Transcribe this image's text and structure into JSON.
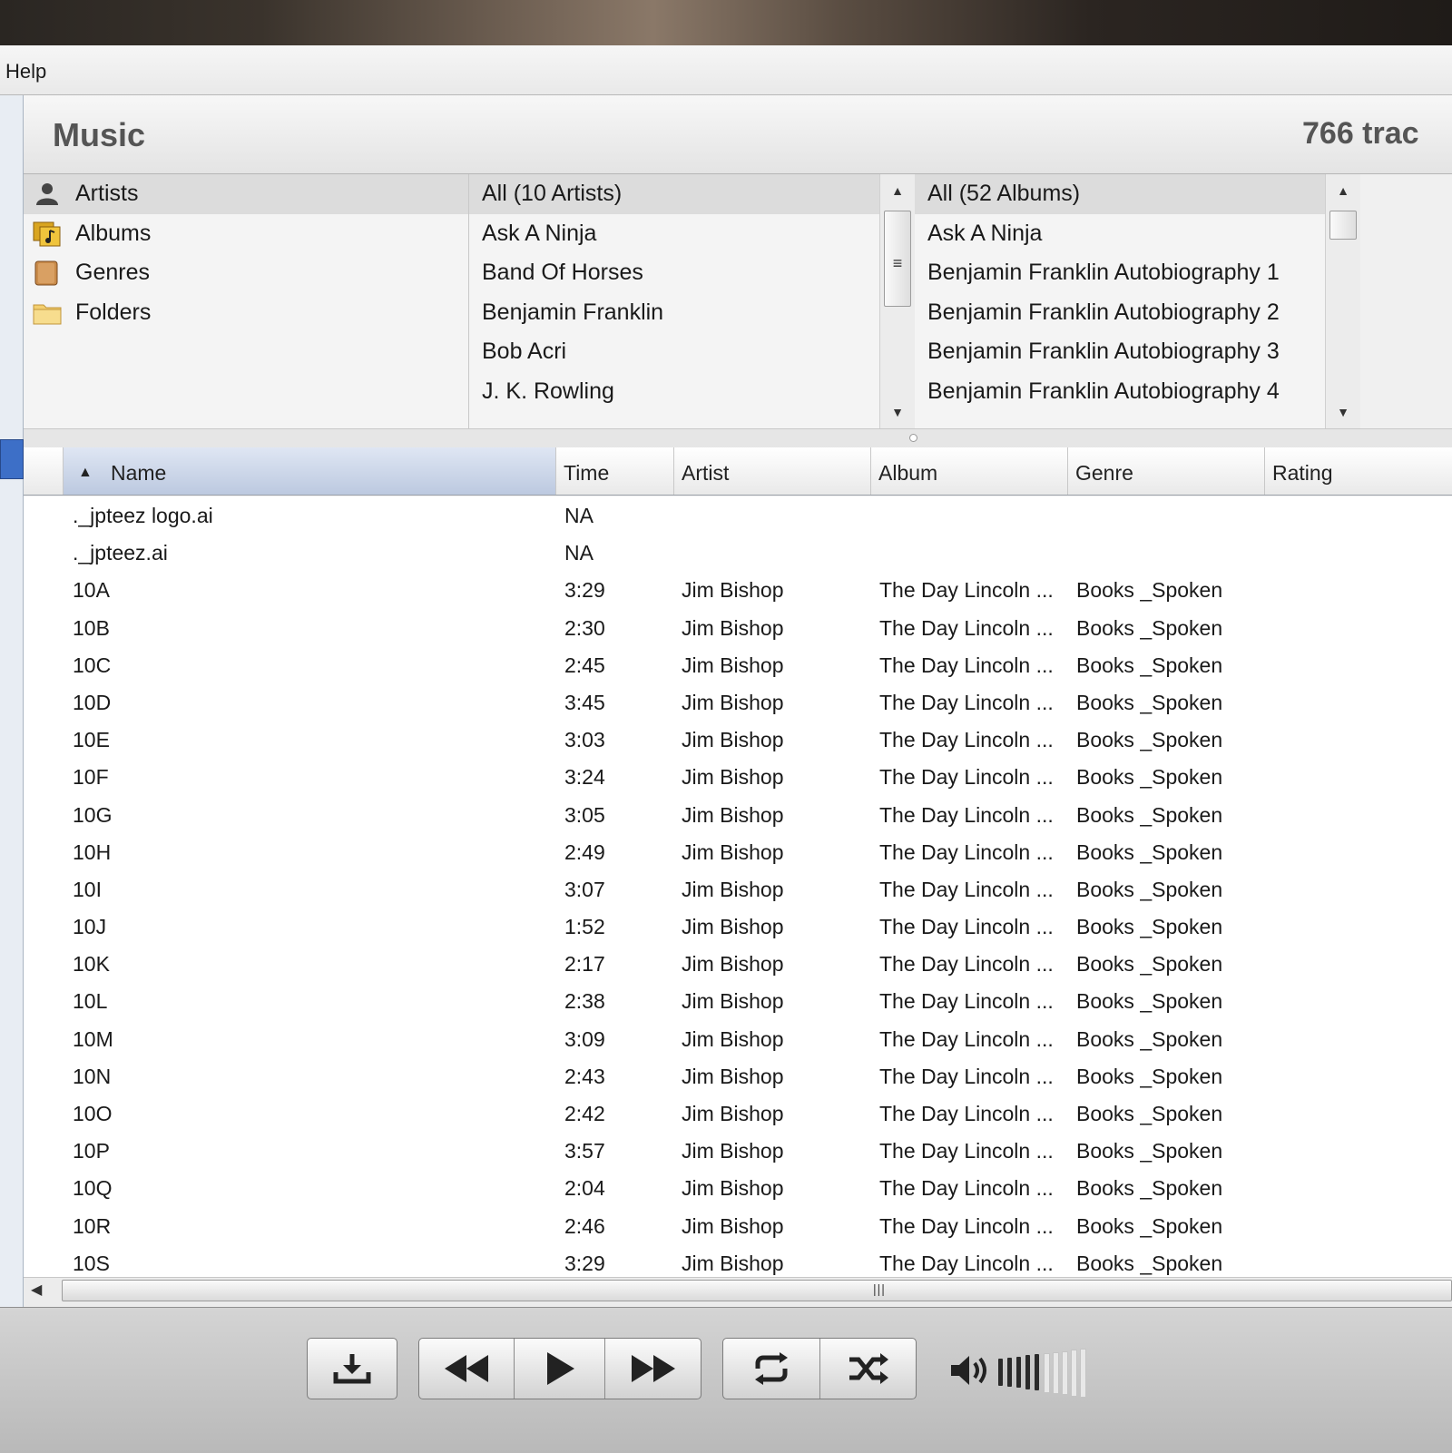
{
  "menu": {
    "help": "Help"
  },
  "header": {
    "title": "Music",
    "track_count": "766 trac"
  },
  "browser": {
    "categories": [
      {
        "label": "Artists",
        "icon": "person-icon",
        "selected": true
      },
      {
        "label": "Albums",
        "icon": "album-icon",
        "selected": false
      },
      {
        "label": "Genres",
        "icon": "genre-book-icon",
        "selected": false
      },
      {
        "label": "Folders",
        "icon": "folder-icon",
        "selected": false
      }
    ],
    "artists": [
      "All (10 Artists)",
      "Ask A Ninja",
      "Band Of Horses",
      "Benjamin Franklin",
      "Bob Acri",
      "J. K. Rowling"
    ],
    "albums": [
      "All (52 Albums)",
      "Ask A Ninja",
      "Benjamin Franklin Autobiography 1",
      "Benjamin Franklin Autobiography 2",
      "Benjamin Franklin Autobiography 3",
      "Benjamin Franklin Autobiography 4"
    ]
  },
  "table": {
    "columns": [
      "Name",
      "Time",
      "Artist",
      "Album",
      "Genre",
      "Rating"
    ],
    "sorted_column": "Name",
    "rows": [
      [
        "._jpteez logo.ai",
        "NA",
        "",
        "",
        "",
        ""
      ],
      [
        "._jpteez.ai",
        "NA",
        "",
        "",
        "",
        ""
      ],
      [
        "10A",
        "3:29",
        "Jim Bishop",
        "The Day Lincoln ...",
        "Books _Spoken",
        ""
      ],
      [
        "10B",
        "2:30",
        "Jim Bishop",
        "The Day Lincoln ...",
        "Books _Spoken",
        ""
      ],
      [
        "10C",
        "2:45",
        "Jim Bishop",
        "The Day Lincoln ...",
        "Books _Spoken",
        ""
      ],
      [
        "10D",
        "3:45",
        "Jim Bishop",
        "The Day Lincoln ...",
        "Books _Spoken",
        ""
      ],
      [
        "10E",
        "3:03",
        "Jim Bishop",
        "The Day Lincoln ...",
        "Books _Spoken",
        ""
      ],
      [
        "10F",
        "3:24",
        "Jim Bishop",
        "The Day Lincoln ...",
        "Books _Spoken",
        ""
      ],
      [
        "10G",
        "3:05",
        "Jim Bishop",
        "The Day Lincoln ...",
        "Books _Spoken",
        ""
      ],
      [
        "10H",
        "2:49",
        "Jim Bishop",
        "The Day Lincoln ...",
        "Books _Spoken",
        ""
      ],
      [
        "10I",
        "3:07",
        "Jim Bishop",
        "The Day Lincoln ...",
        "Books _Spoken",
        ""
      ],
      [
        "10J",
        "1:52",
        "Jim Bishop",
        "The Day Lincoln ...",
        "Books _Spoken",
        ""
      ],
      [
        "10K",
        "2:17",
        "Jim Bishop",
        "The Day Lincoln ...",
        "Books _Spoken",
        ""
      ],
      [
        "10L",
        "2:38",
        "Jim Bishop",
        "The Day Lincoln ...",
        "Books _Spoken",
        ""
      ],
      [
        "10M",
        "3:09",
        "Jim Bishop",
        "The Day Lincoln ...",
        "Books _Spoken",
        ""
      ],
      [
        "10N",
        "2:43",
        "Jim Bishop",
        "The Day Lincoln ...",
        "Books _Spoken",
        ""
      ],
      [
        "10O",
        "2:42",
        "Jim Bishop",
        "The Day Lincoln ...",
        "Books _Spoken",
        ""
      ],
      [
        "10P",
        "3:57",
        "Jim Bishop",
        "The Day Lincoln ...",
        "Books _Spoken",
        ""
      ],
      [
        "10Q",
        "2:04",
        "Jim Bishop",
        "The Day Lincoln ...",
        "Books _Spoken",
        ""
      ],
      [
        "10R",
        "2:46",
        "Jim Bishop",
        "The Day Lincoln ...",
        "Books _Spoken",
        ""
      ],
      [
        "10S",
        "3:29",
        "Jim Bishop",
        "The Day Lincoln ...",
        "Books _Spoken",
        ""
      ]
    ]
  },
  "controls": {
    "buttons": [
      {
        "name": "download-button",
        "icon": "download-icon"
      },
      {
        "name": "previous-button",
        "icon": "rewind-icon"
      },
      {
        "name": "play-button",
        "icon": "play-icon"
      },
      {
        "name": "next-button",
        "icon": "fast-forward-icon"
      },
      {
        "name": "repeat-button",
        "icon": "repeat-icon"
      },
      {
        "name": "shuffle-button",
        "icon": "shuffle-icon"
      }
    ],
    "volume_level": 0.5
  },
  "colors": {
    "selection": "#3d6fc7",
    "sorted_header": "#c8d3e6"
  }
}
